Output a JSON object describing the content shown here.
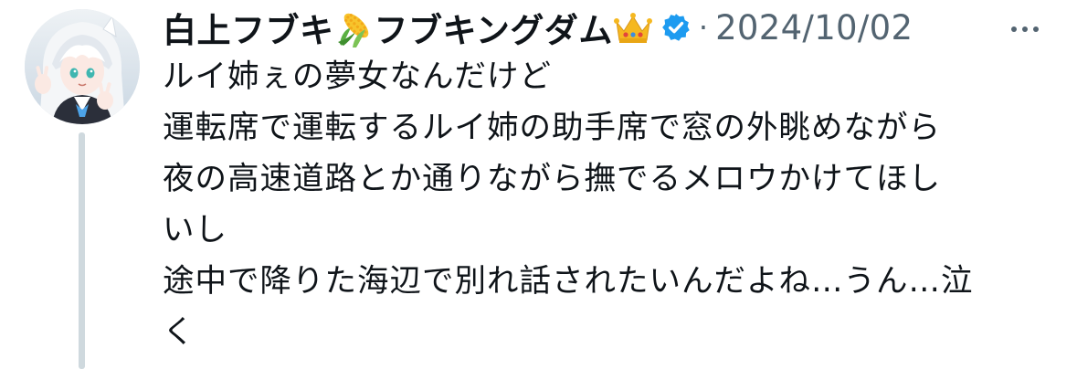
{
  "tweet": {
    "author": {
      "display_name_part1": "白上フブキ",
      "display_name_part2": "フブキングダム",
      "emoji_1": "corn-emoji",
      "emoji_2": "crown-emoji",
      "verified_icon": "verified-badge-icon",
      "avatar_icon": "avatar-image"
    },
    "separator": "·",
    "date": "2024/10/02",
    "more_icon": "more-options-icon",
    "body_lines": [
      "ルイ姉ぇの夢女なんだけど",
      "運転席で運転するルイ姉の助手席で窓の外眺めながら",
      "夜の高速道路とか通りながら撫でるメロウかけてほし",
      "いし",
      "途中で降りた海辺で別れ話されたいんだよね…うん…泣",
      "く"
    ]
  },
  "colors": {
    "text_primary": "#0f1419",
    "text_secondary": "#536471",
    "verified_blue": "#1d9bf0",
    "thread_line": "#cfd9de"
  }
}
